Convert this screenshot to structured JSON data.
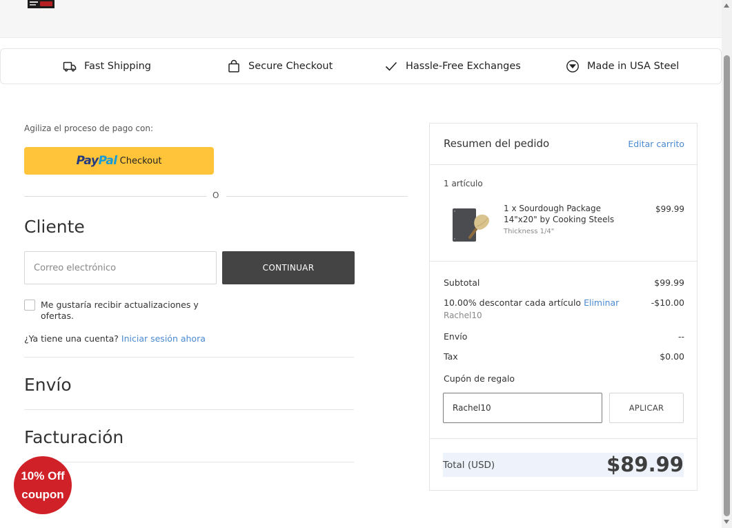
{
  "benefits": [
    {
      "label": "Fast Shipping",
      "icon": "truck-icon"
    },
    {
      "label": "Secure Checkout",
      "icon": "shopping-bag-icon"
    },
    {
      "label": "Hassle-Free Exchanges",
      "icon": "checkmark-icon"
    },
    {
      "label": "Made in USA Steel",
      "icon": "compass-icon"
    }
  ],
  "express": {
    "label": "Agiliza el proceso de pago con:",
    "paypal_pay": "Pay",
    "paypal_pal": "Pal",
    "paypal_checkout": "Checkout"
  },
  "or_text": "O",
  "customer": {
    "title": "Cliente",
    "email_placeholder": "Correo electrónico",
    "email_value": "",
    "continue_label": "CONTINUAR",
    "newsletter_label": "Me gustaría recibir actualizaciones y ofertas.",
    "newsletter_checked": false,
    "account_prompt": "¿Ya tiene una cuenta?",
    "login_link": "Iniciar sesión ahora"
  },
  "shipping": {
    "title": "Envío"
  },
  "billing": {
    "title": "Facturación"
  },
  "coupon_badge": {
    "line1": "10% Off",
    "line2": "coupon"
  },
  "summary": {
    "title": "Resumen del pedido",
    "edit_cart": "Editar carrito",
    "item_count": "1 artículo",
    "item": {
      "name": "1 x Sourdough Package 14\"x20\" by Cooking Steels",
      "variant": "Thickness 1/4\"",
      "price": "$99.99"
    },
    "subtotal_label": "Subtotal",
    "subtotal_value": "$99.99",
    "discount_label": "10.00% descontar cada artículo",
    "discount_remove": "Eliminar",
    "discount_code": "Rachel10",
    "discount_value": "-$10.00",
    "shipping_label": "Envío",
    "shipping_value": "--",
    "tax_label": "Tax",
    "tax_value": "$0.00",
    "gift_label": "Cupón de regalo",
    "gift_value": "Rachel10",
    "apply_label": "APLICAR",
    "total_label": "Total (USD)",
    "total_value": "$89.99"
  },
  "colors": {
    "paypal_yellow": "#ffc439",
    "link_blue": "#4a8ad1",
    "badge_red": "#d02128",
    "button_dark": "#444444"
  }
}
